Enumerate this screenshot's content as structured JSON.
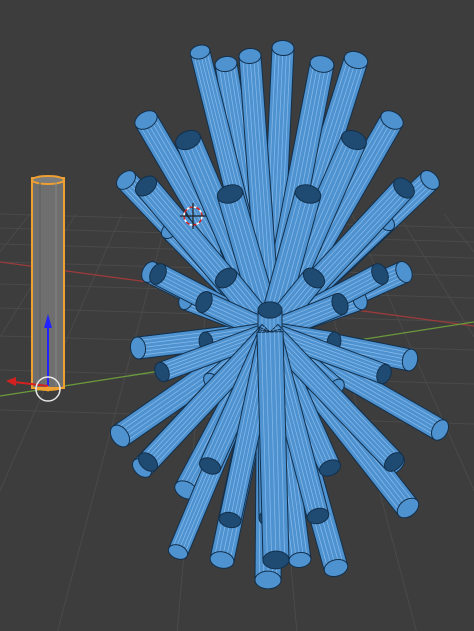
{
  "viewport": {
    "kind": "3d-viewport",
    "background_color": "#3d3d3d",
    "grid_color": "#4a4a4a",
    "axes": {
      "x_axis_color": "#9b3b3b",
      "y_axis_color": "#6b9a3b",
      "z_gizmo_color": "#2323ff",
      "x_gizmo_color": "#d42020"
    }
  },
  "objects": {
    "cylinder": {
      "icon": "cylinder-mesh",
      "state": "selected",
      "outline_color": "#f0a030",
      "fill_color": "#6f6f6f"
    },
    "cluster": {
      "icon": "cylinder-cluster-mesh",
      "state": "edit-mode",
      "fill_color": "#4f92d0",
      "cap_color": "#1f4a72",
      "wire_color": "#9ccaf5",
      "edge_color": "#12304c"
    }
  }
}
